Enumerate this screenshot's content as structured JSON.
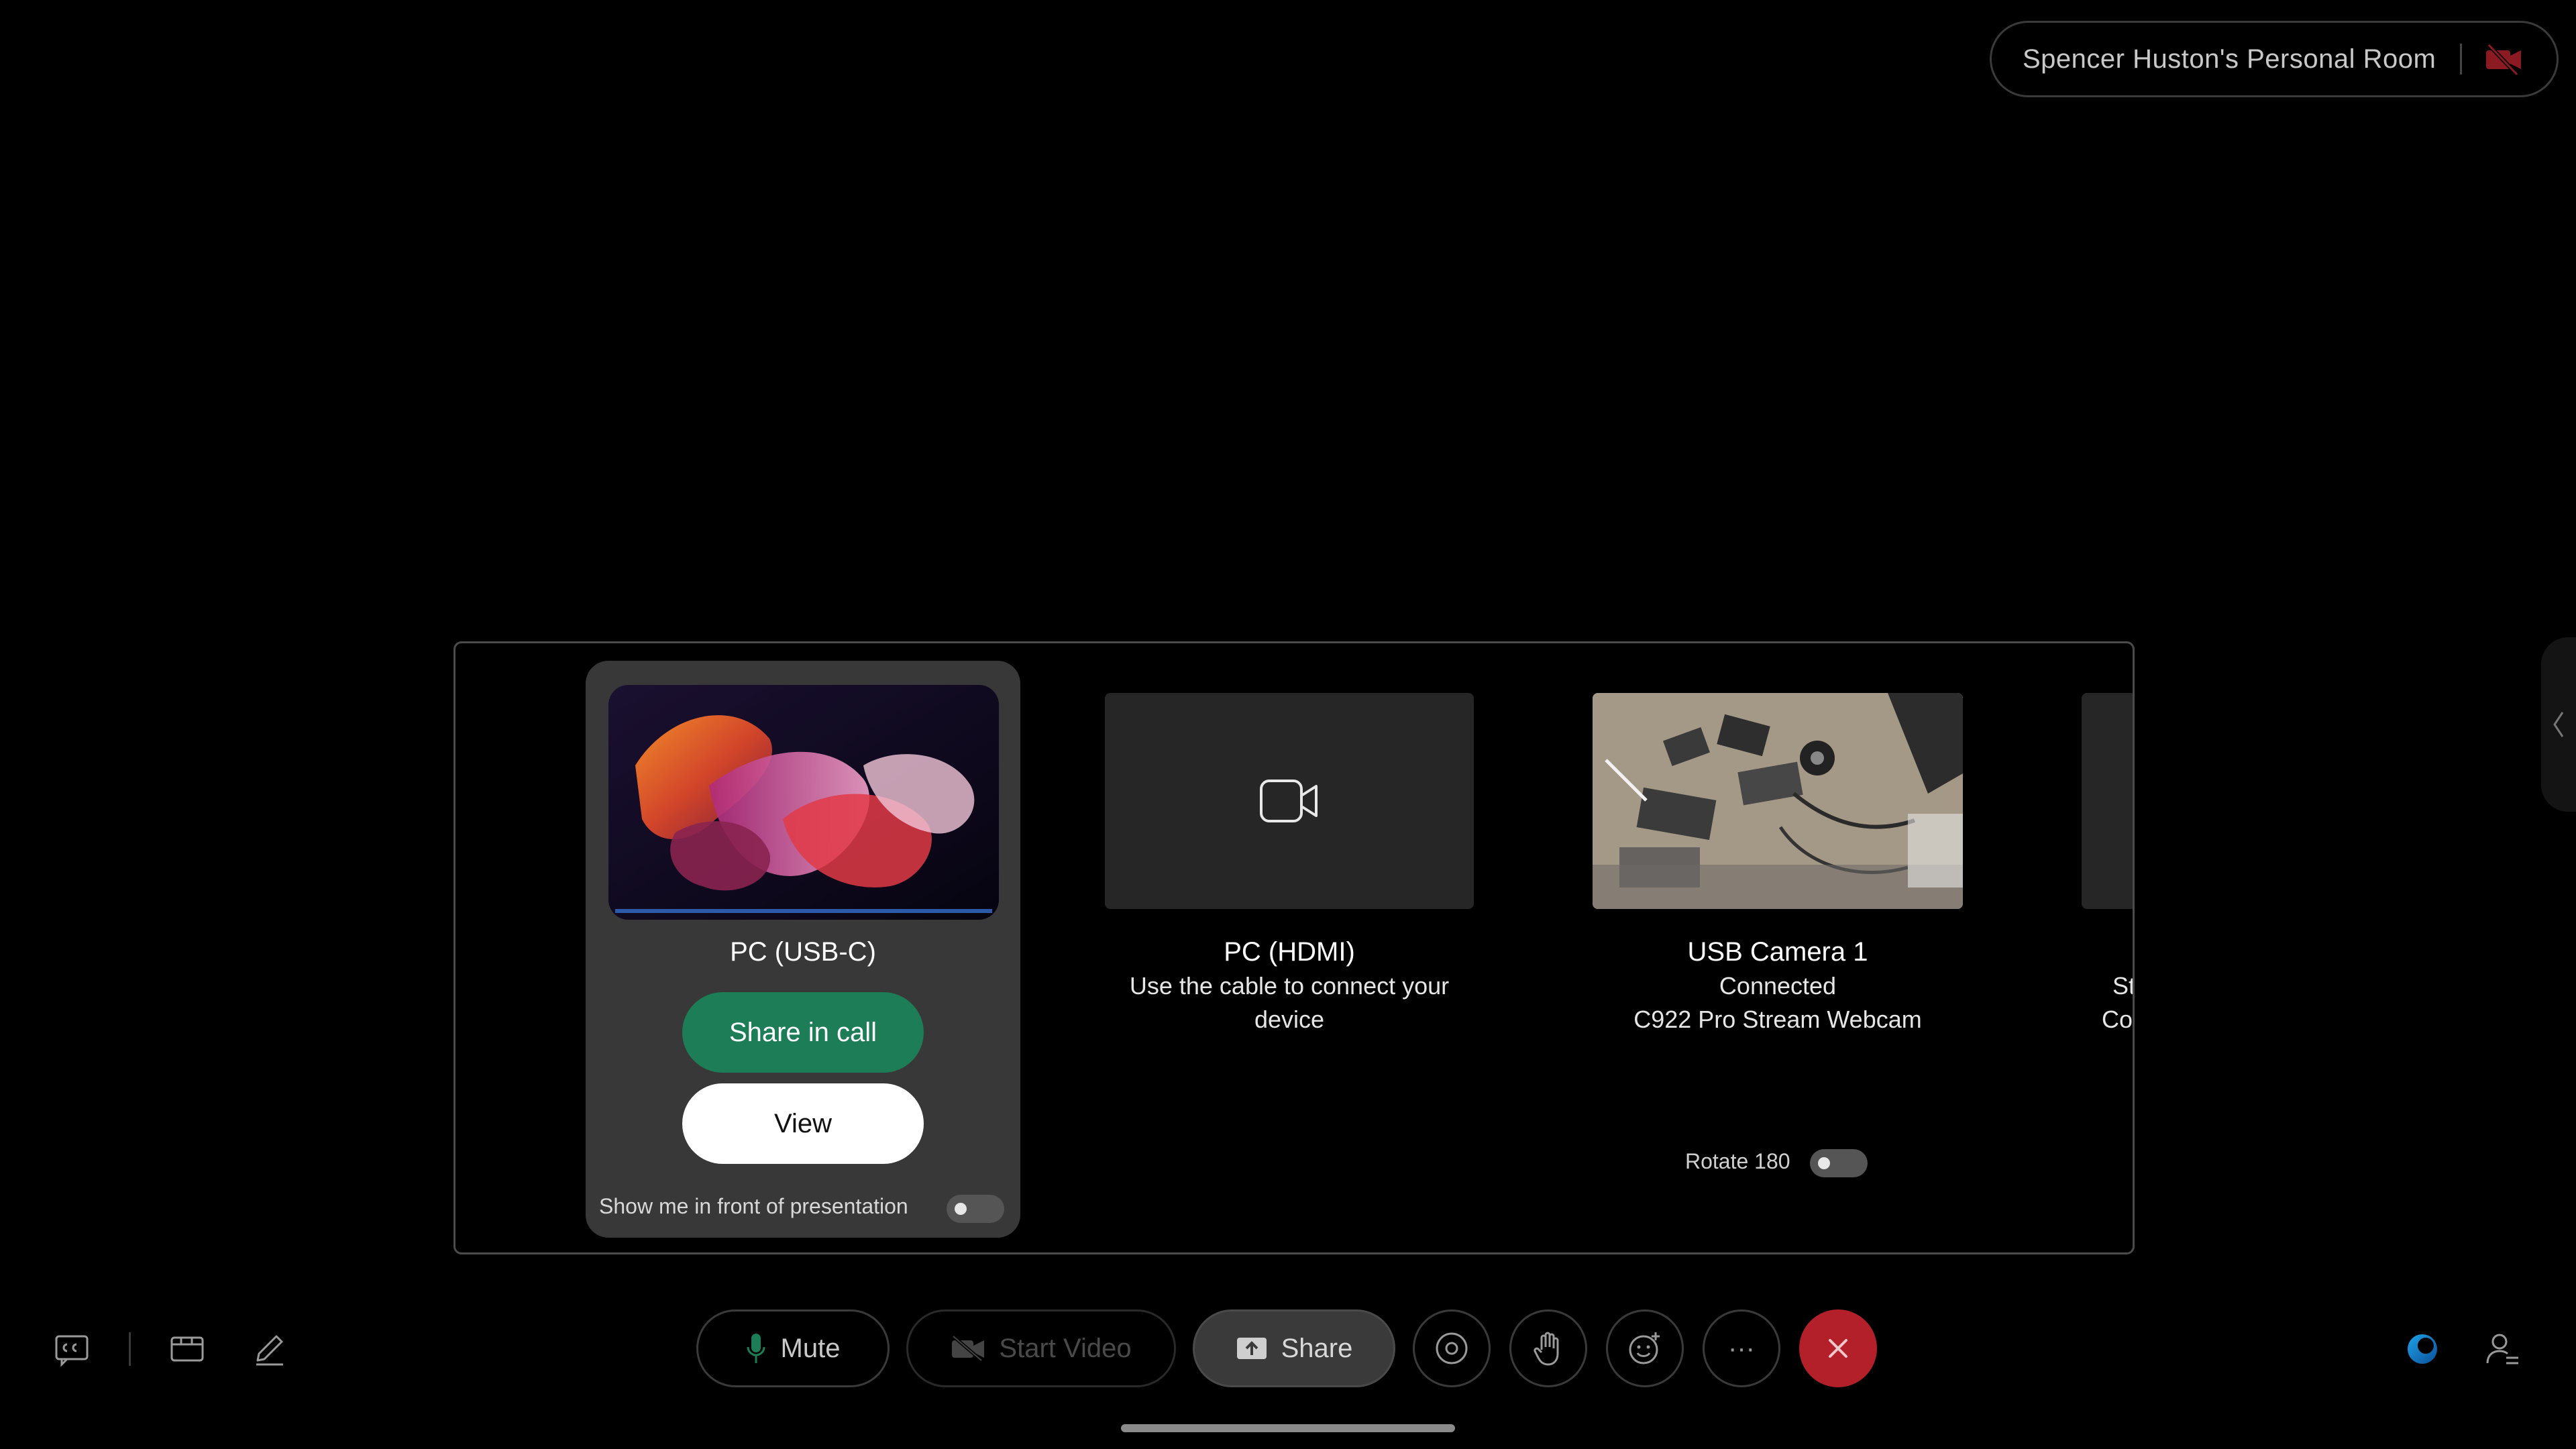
{
  "room": {
    "name": "Spencer Huston's Personal Room"
  },
  "sources": [
    {
      "title": "PC (USB-C)",
      "share_label": "Share in call",
      "view_label": "View",
      "toggle_label": "Show me in front of presentation"
    },
    {
      "title": "PC (HDMI)",
      "line1": "Use the cable to connect your",
      "line2": "device"
    },
    {
      "title": "USB Camera 1",
      "line1": "Connected",
      "line2": "C922 Pro Stream Webcam",
      "toggle_label": "Rotate 180"
    },
    {
      "title": "",
      "line1": "St",
      "line2": "Co"
    }
  ],
  "toolbar": {
    "mute_label": "Mute",
    "start_video_label": "Start Video",
    "share_label": "Share",
    "more_label": "···"
  },
  "colors": {
    "accent_green": "#1d7d56",
    "end_call_red": "#b3202a"
  }
}
